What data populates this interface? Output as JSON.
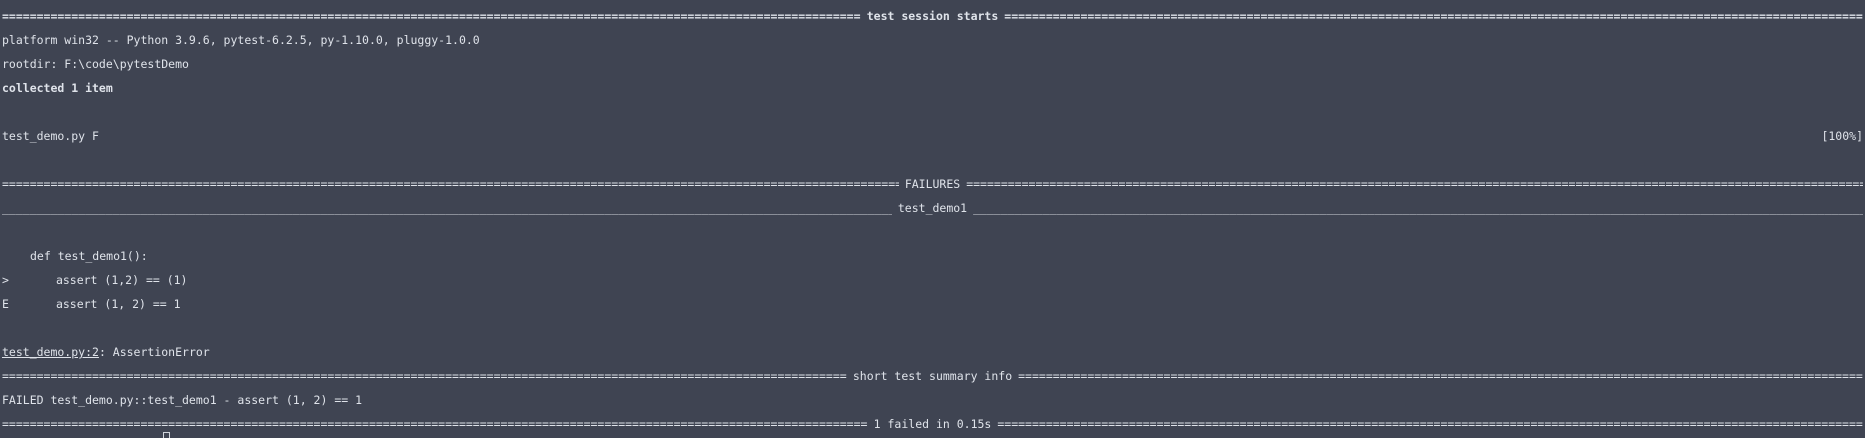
{
  "terminal": {
    "session_title": "test session starts",
    "platform": "platform win32 -- Python 3.9.6, pytest-6.2.5, py-1.10.0, pluggy-1.0.0",
    "rootdir": "rootdir: F:\\code\\pytestDemo",
    "collected": "collected 1 item",
    "progress": {
      "file": "test_demo.py F",
      "percent": "[100%]"
    },
    "failures_title": "FAILURES",
    "test_name": "test_demo1",
    "code_def": "def test_demo1():",
    "marker_arrow": ">",
    "code_assert": "assert (1,2) == (1)",
    "marker_error": "E",
    "error_assert": "assert (1, 2) == 1",
    "error_location_link": "test_demo.py:2",
    "error_type": ": AssertionError",
    "summary_title": "short test summary info",
    "failed_line": "FAILED test_demo.py::test_demo1 - assert (1, 2) == 1",
    "result_title": "1 failed in 0.15s"
  }
}
